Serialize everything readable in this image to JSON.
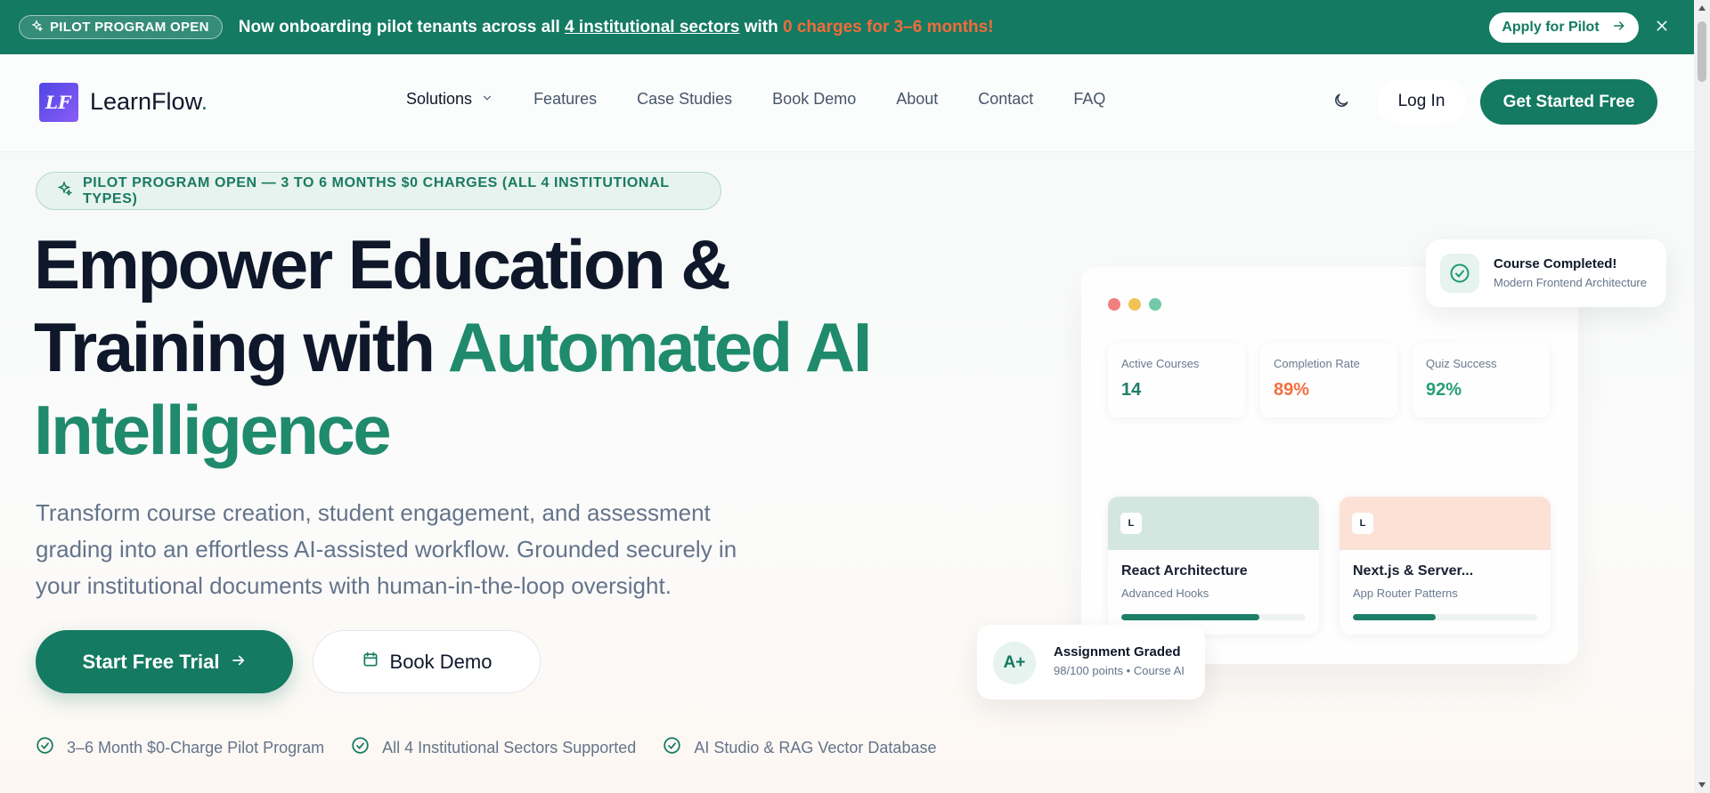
{
  "announcement": {
    "pill_label": "PILOT PROGRAM OPEN",
    "text_before": "Now onboarding pilot tenants across all ",
    "text_link": "4 institutional sectors",
    "text_middle": " with ",
    "text_highlight": "0 charges for 3–6 months!",
    "apply_label": "Apply for Pilot",
    "close_icon": "close-icon"
  },
  "header": {
    "logo_initials": "LF",
    "brand": "LearnFlow",
    "brand_dot": ".",
    "nav": [
      "Solutions",
      "Features",
      "Case Studies",
      "Book Demo",
      "About",
      "Contact",
      "FAQ"
    ],
    "login_label": "Log In",
    "cta_label": "Get Started Free",
    "theme_icon": "moon-icon"
  },
  "hero": {
    "badge": "PILOT PROGRAM OPEN — 3 TO 6 MONTHS $0 CHARGES (ALL 4 INSTITUTIONAL TYPES)",
    "title_line1": "Empower Education &",
    "title_line2_plain": "Training with ",
    "title_line2_accent": "Automated AI",
    "title_line3_accent": "Intelligence",
    "lede": "Transform course creation, student engagement, and assessment grading into an effortless AI-assisted workflow. Grounded securely in your institutional documents with human-in-the-loop oversight.",
    "primary_cta": "Start Free Trial",
    "secondary_cta": "Book Demo",
    "checks": [
      "3–6 Month $0-Charge Pilot Program",
      "All 4 Institutional Sectors Supported",
      "AI Studio & RAG Vector Database"
    ]
  },
  "dashboard": {
    "stats": [
      {
        "label": "Active Courses",
        "value": "14",
        "color": "#147a62"
      },
      {
        "label": "Completion Rate",
        "value": "89%",
        "color": "#f26b3a"
      },
      {
        "label": "Quiz Success",
        "value": "92%",
        "color": "#1f9b6e"
      }
    ],
    "courses": [
      {
        "tag": "L",
        "title": "React Architecture",
        "subtitle": "Advanced Hooks",
        "progress": 0.75,
        "band_color": "#d2e6de"
      },
      {
        "tag": "L",
        "title": "Next.js & Server...",
        "subtitle": "App Router Patterns",
        "progress": 0.45,
        "band_color": "#fde0d6"
      }
    ],
    "window_dots": [
      "#f07a7a",
      "#f3c04f",
      "#6cc9a5"
    ]
  },
  "completed_card": {
    "title": "Course Completed!",
    "subtitle": "Modern Frontend Architecture"
  },
  "graded_card": {
    "grade": "A+",
    "title": "Assignment Graded",
    "subtitle": "98/100 points • Course AI"
  },
  "colors": {
    "brand": "#147a62",
    "accent_orange": "#f26b3a",
    "text_dark": "#0f172a",
    "text_muted": "#64748b"
  }
}
